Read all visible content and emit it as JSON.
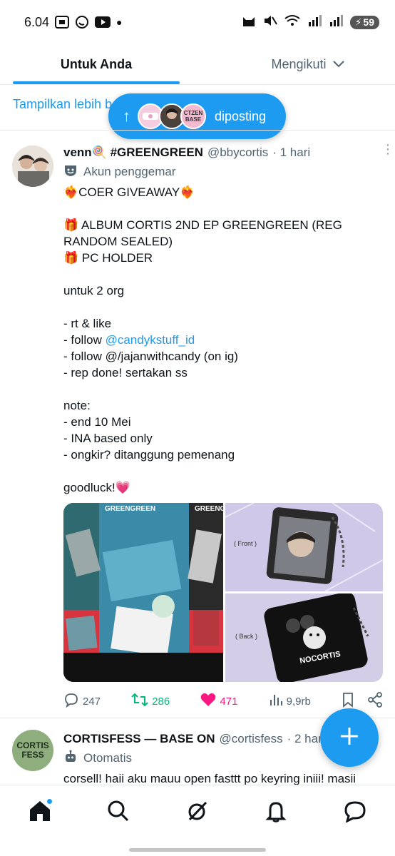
{
  "status_bar": {
    "time": "6.04",
    "battery": "59"
  },
  "tabs": {
    "for_you": "Untuk Anda",
    "following": "Mengikuti"
  },
  "show_more": "Tampilkan lebih b",
  "posted_pill": {
    "label": "diposting",
    "avatar_3_text": "CTZEN BASE"
  },
  "tweet": {
    "name": "venn🍭 #GREENGREEN",
    "handle": "@bbycortis",
    "time": "· 1 hari",
    "badge": "Akun penggemar",
    "lines": {
      "l1": "❤️‍🔥COER GIVEAWAY❤️‍🔥",
      "l2": "🎁 ALBUM CORTIS 2ND EP GREENGREEN (REG RANDOM SEALED)",
      "l3": "🎁 PC HOLDER",
      "l4": "untuk 2 org",
      "l5": "- rt & like",
      "l6_prefix": "- follow ",
      "l6_link": "@candykstuff_id",
      "l7": "- follow @/jajanwithcandy (on ig)",
      "l8": "- rep done! sertakan ss",
      "l9": "note:",
      "l10": "- end 10 Mei",
      "l11": "- INA based only",
      "l12": "- ongkir? ditanggung pemenang",
      "l13": "goodluck!💗"
    },
    "media": {
      "album_title_1": "GREENGREEN",
      "album_title_2": "GREENGR",
      "front_label": "( Front )",
      "back_label": "( Back )",
      "charm_text": "NOCORTIS"
    },
    "stats": {
      "replies": "247",
      "retweets": "286",
      "likes": "471",
      "views": "9,9rb"
    }
  },
  "tweet2": {
    "avatar_text": "CORTIS FESS",
    "name": "CORTISFESS — BASE ON",
    "handle": "@cortisfess",
    "time": "· 2 hari",
    "badge": "Otomatis",
    "text": "corsell! haii aku mauu open fasttt po keyring iniii! masii"
  },
  "colors": {
    "accent": "#1d9bf0",
    "retweet": "#00ba7c",
    "like": "#f91880",
    "muted": "#536471"
  }
}
